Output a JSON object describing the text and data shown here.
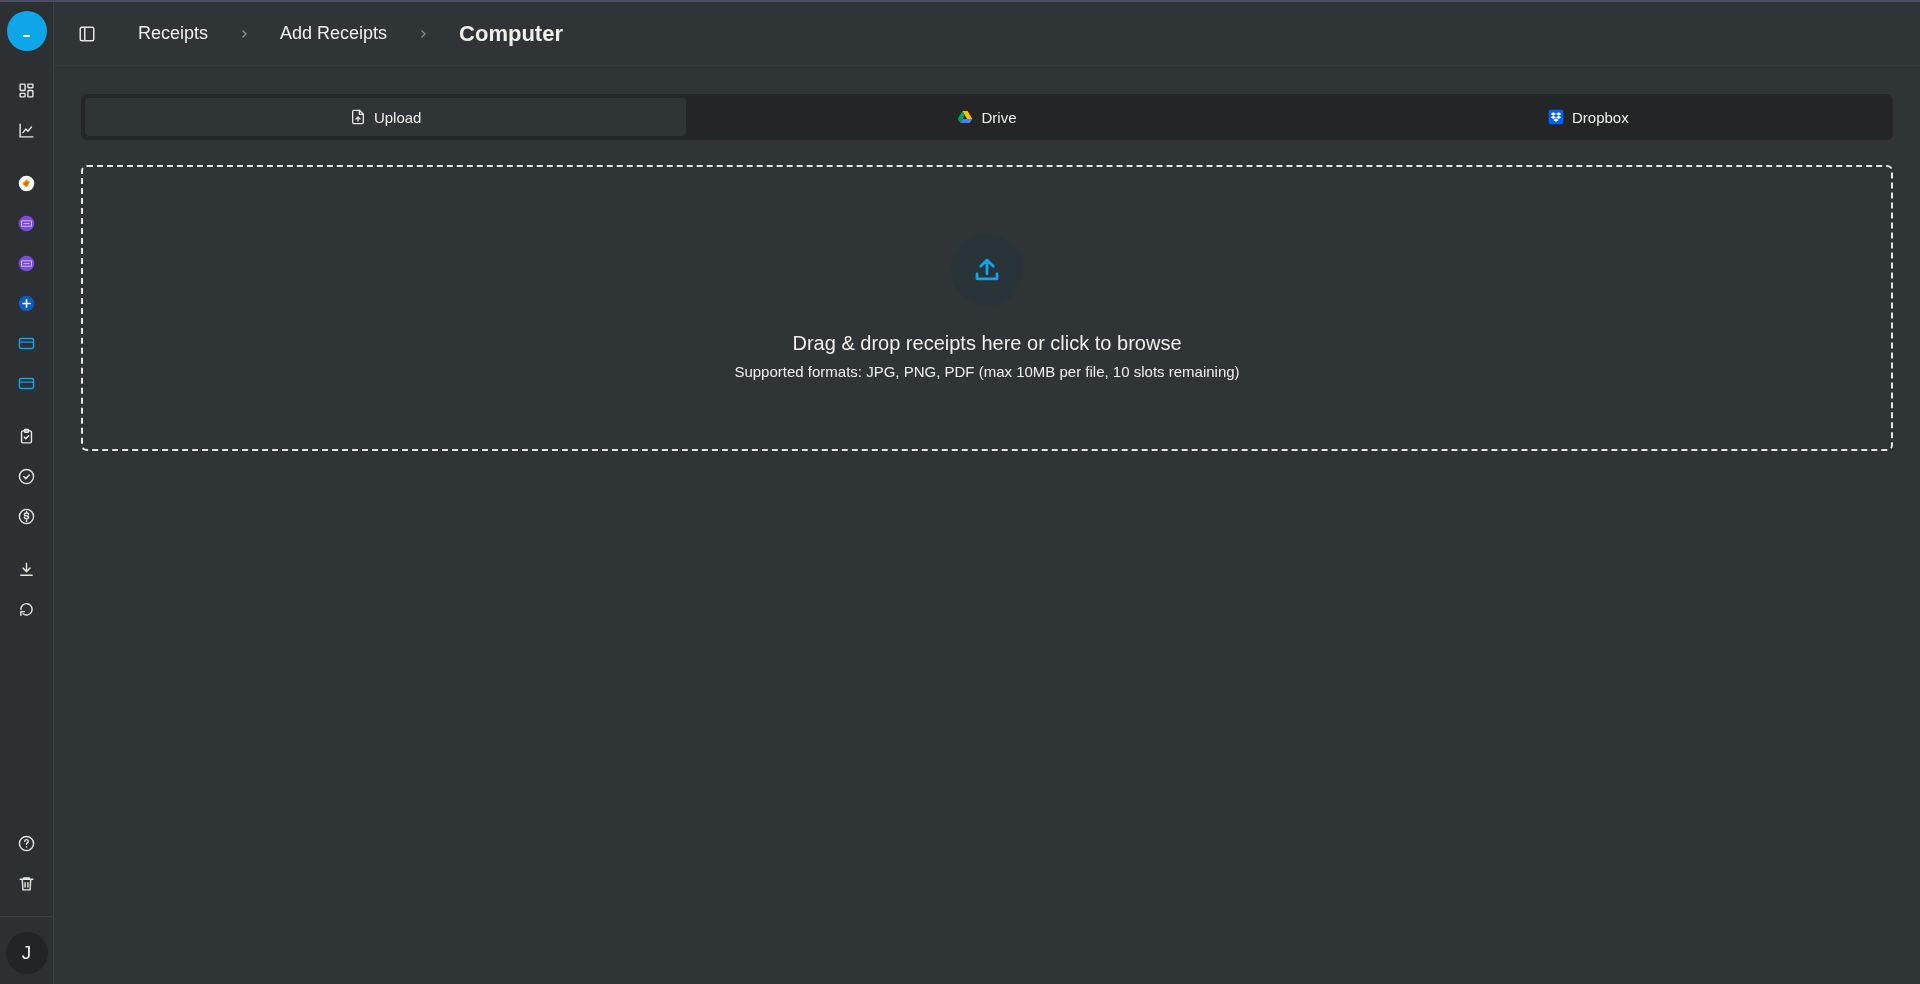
{
  "sidebar": {
    "groups": [
      [
        {
          "kind": "grid"
        },
        {
          "kind": "chart"
        }
      ],
      [
        {
          "kind": "app-orange"
        },
        {
          "kind": "app-purple"
        },
        {
          "kind": "app-purple"
        },
        {
          "kind": "app-plus"
        },
        {
          "kind": "card"
        },
        {
          "kind": "card"
        }
      ],
      [
        {
          "kind": "clipboard"
        },
        {
          "kind": "check"
        },
        {
          "kind": "dollar"
        }
      ],
      [
        {
          "kind": "download"
        },
        {
          "kind": "refresh"
        }
      ]
    ],
    "bottom": [
      {
        "kind": "help"
      },
      {
        "kind": "trash"
      }
    ],
    "avatar": "J"
  },
  "breadcrumb": [
    "Receipts",
    "Add Receipts",
    "Computer"
  ],
  "tabs": [
    {
      "label": "Upload",
      "kind": "upload",
      "selected": true
    },
    {
      "label": "Drive",
      "kind": "drive",
      "selected": false
    },
    {
      "label": "Dropbox",
      "kind": "dropbox",
      "selected": false
    }
  ],
  "dropzone": {
    "title": "Drag & drop receipts here or click to browse",
    "subtitle": "Supported formats: JPG, PNG, PDF (max 10MB per file, 10 slots remaining)"
  }
}
